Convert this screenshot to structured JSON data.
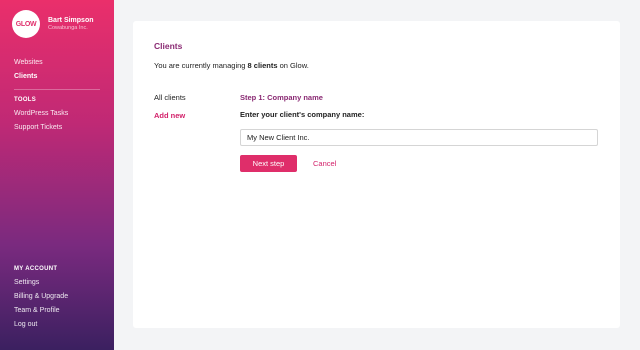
{
  "sidebar": {
    "logo_text": "GLOW",
    "user_name": "Bart Simpson",
    "company": "Cowabunga Inc.",
    "nav_top": [
      "Websites",
      "Clients"
    ],
    "active_item": "Clients",
    "tools_heading": "TOOLS",
    "tools": [
      "WordPress Tasks",
      "Support Tickets"
    ],
    "account_heading": "MY ACCOUNT",
    "account": [
      "Settings",
      "Billing & Upgrade",
      "Team & Profile",
      "Log out"
    ],
    "colors": {
      "gradient_top": "#ea2f6b",
      "gradient_bottom": "#3b2060"
    }
  },
  "main": {
    "title": "Clients",
    "summary_prefix": "You are currently managing ",
    "summary_count": "8 clients",
    "summary_suffix": " on Glow.",
    "links": {
      "all": "All clients",
      "add": "Add new"
    },
    "step_title": "Step 1: Company name",
    "field_label": "Enter your client's company name:",
    "input_value": "My New Client Inc.",
    "next_button": "Next step",
    "cancel_button": "Cancel",
    "accent_color": "#df2e6a"
  }
}
